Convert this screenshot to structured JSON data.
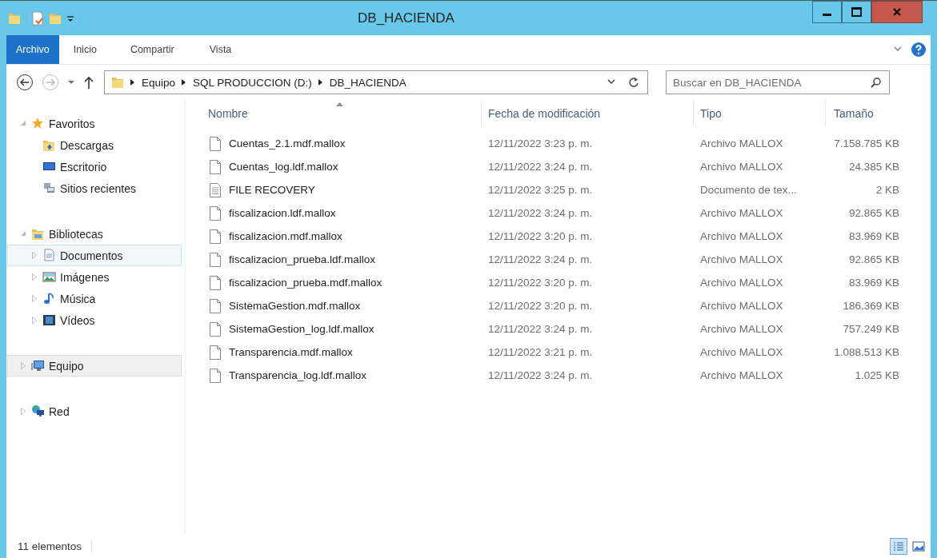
{
  "window": {
    "title": "DB_HACIENDA"
  },
  "ribbon_tabs": [
    {
      "label": "Archivo",
      "selected": true
    },
    {
      "label": "Inicio",
      "selected": false
    },
    {
      "label": "Compartir",
      "selected": false
    },
    {
      "label": "Vista",
      "selected": false
    }
  ],
  "address_bar": {
    "path": [
      "Equipo",
      "SQL PRODUCCION (D:)",
      "DB_HACIENDA"
    ]
  },
  "search": {
    "placeholder": "Buscar en DB_HACIENDA"
  },
  "sidebar": {
    "items": [
      {
        "label": "Favoritos",
        "kind": "favorites",
        "expanded": true,
        "selected": false,
        "hovered": false,
        "children": [
          {
            "label": "Descargas",
            "kind": "downloads",
            "selected": false,
            "hovered": false
          },
          {
            "label": "Escritorio",
            "kind": "desktop",
            "selected": false,
            "hovered": false
          },
          {
            "label": "Sitios recientes",
            "kind": "recent",
            "selected": false,
            "hovered": false
          }
        ]
      },
      {
        "label": "Bibliotecas",
        "kind": "libraries",
        "expanded": true,
        "selected": false,
        "hovered": false,
        "children": [
          {
            "label": "Documentos",
            "kind": "documents",
            "expanded": false,
            "selected": false,
            "hovered": true
          },
          {
            "label": "Imágenes",
            "kind": "pictures",
            "expanded": false,
            "selected": false,
            "hovered": false
          },
          {
            "label": "Música",
            "kind": "music",
            "expanded": false,
            "selected": false,
            "hovered": false
          },
          {
            "label": "Vídeos",
            "kind": "videos",
            "expanded": false,
            "selected": false,
            "hovered": false
          }
        ]
      },
      {
        "label": "Equipo",
        "kind": "computer",
        "expanded": false,
        "selected": true,
        "hovered": false
      },
      {
        "label": "Red",
        "kind": "network",
        "expanded": false,
        "selected": false,
        "hovered": false
      }
    ]
  },
  "table": {
    "columns": [
      {
        "label": "Nombre",
        "sorted": true
      },
      {
        "label": "Fecha de modificación",
        "sorted": false
      },
      {
        "label": "Tipo",
        "sorted": false
      },
      {
        "label": "Tamaño",
        "sorted": false
      }
    ],
    "rows": [
      {
        "kind": "file",
        "name": "Cuentas_2.1.mdf.mallox",
        "date": "12/11/2022 3:23 p. m.",
        "type": "Archivo MALLOX",
        "size": "7.158.785 KB"
      },
      {
        "kind": "file",
        "name": "Cuentas_log.ldf.mallox",
        "date": "12/11/2022 3:24 p. m.",
        "type": "Archivo MALLOX",
        "size": "24.385 KB"
      },
      {
        "kind": "text",
        "name": "FILE RECOVERY",
        "date": "12/11/2022 3:25 p. m.",
        "type": "Documento de tex...",
        "size": "2 KB"
      },
      {
        "kind": "file",
        "name": "fiscalizacion.ldf.mallox",
        "date": "12/11/2022 3:24 p. m.",
        "type": "Archivo MALLOX",
        "size": "92.865 KB"
      },
      {
        "kind": "file",
        "name": "fiscalizacion.mdf.mallox",
        "date": "12/11/2022 3:20 p. m.",
        "type": "Archivo MALLOX",
        "size": "83.969 KB"
      },
      {
        "kind": "file",
        "name": "fiscalizacion_prueba.ldf.mallox",
        "date": "12/11/2022 3:24 p. m.",
        "type": "Archivo MALLOX",
        "size": "92.865 KB"
      },
      {
        "kind": "file",
        "name": "fiscalizacion_prueba.mdf.mallox",
        "date": "12/11/2022 3:20 p. m.",
        "type": "Archivo MALLOX",
        "size": "83.969 KB"
      },
      {
        "kind": "file",
        "name": "SistemaGestion.mdf.mallox",
        "date": "12/11/2022 3:20 p. m.",
        "type": "Archivo MALLOX",
        "size": "186.369 KB"
      },
      {
        "kind": "file",
        "name": "SistemaGestion_log.ldf.mallox",
        "date": "12/11/2022 3:24 p. m.",
        "type": "Archivo MALLOX",
        "size": "757.249 KB"
      },
      {
        "kind": "file",
        "name": "Transparencia.mdf.mallox",
        "date": "12/11/2022 3:21 p. m.",
        "type": "Archivo MALLOX",
        "size": "1.088.513 KB"
      },
      {
        "kind": "file",
        "name": "Transparencia_log.ldf.mallox",
        "date": "12/11/2022 3:24 p. m.",
        "type": "Archivo MALLOX",
        "size": "1.025 KB"
      }
    ]
  },
  "status_bar": {
    "count": "11 elementos",
    "views": [
      {
        "kind": "details",
        "selected": true
      },
      {
        "kind": "tiles",
        "selected": false
      }
    ]
  }
}
